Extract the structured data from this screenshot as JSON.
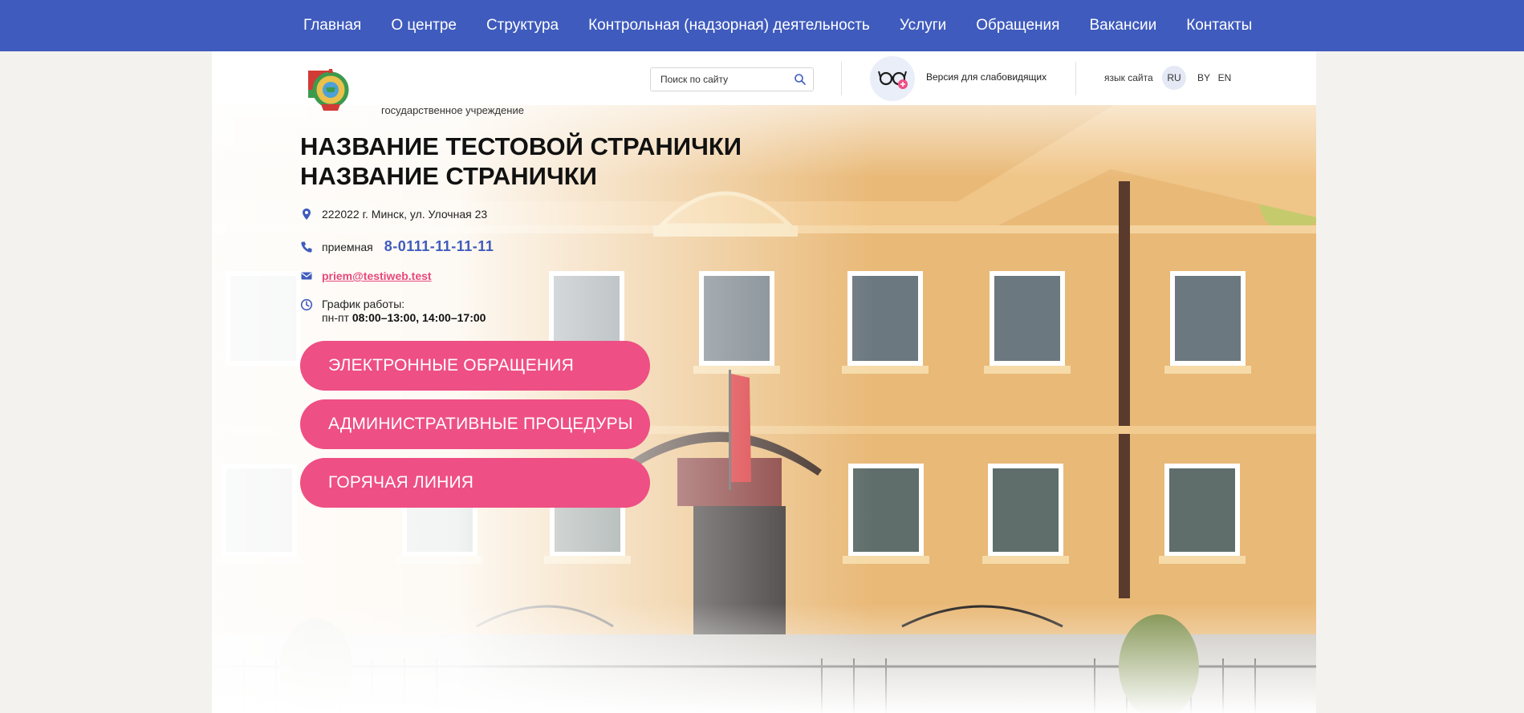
{
  "nav": {
    "items": [
      {
        "label": "Главная"
      },
      {
        "label": "О центре"
      },
      {
        "label": "Структура"
      },
      {
        "label": "Контрольная (надзорная) деятельность"
      },
      {
        "label": "Услуги"
      },
      {
        "label": "Обращения"
      },
      {
        "label": "Вакансии"
      },
      {
        "label": "Контакты"
      }
    ]
  },
  "header": {
    "org_type": "государственное учреждение",
    "search": {
      "placeholder": "Поиск по сайту",
      "icon": "search-icon"
    },
    "accessibility": {
      "label": "Версия для слабовидящих",
      "icon": "glasses-icon"
    },
    "language": {
      "label": "язык сайта",
      "options": [
        "RU",
        "BY",
        "EN"
      ],
      "active": "RU"
    }
  },
  "org": {
    "title_line1": "НАЗВАНИЕ ТЕСТОВОЙ СТРАНИЧКИ",
    "title_line2": "НАЗВАНИЕ СТРАНИЧКИ",
    "address": "222022 г. Минск, ул. Улочная 23",
    "phone_label": "приемная",
    "phone": "8-0111-11-11-11",
    "email": "priem@testiweb.test",
    "schedule_label": "График работы:",
    "schedule_days": "пн-пт",
    "schedule_hours": "08:00–13:00, 14:00–17:00"
  },
  "actions": [
    {
      "label": "ЭЛЕКТРОННЫЕ ОБРАЩЕНИЯ"
    },
    {
      "label": "АДМИНИСТРАТИВНЫЕ ПРОЦЕДУРЫ"
    },
    {
      "label": "ГОРЯЧАЯ ЛИНИЯ"
    }
  ],
  "colors": {
    "nav_bg": "#3f5bbd",
    "accent_pink": "#ee4f84",
    "phone_blue": "#3f5bbd",
    "page_bg": "#f3f2ef",
    "building_wall": "#e8b874"
  }
}
